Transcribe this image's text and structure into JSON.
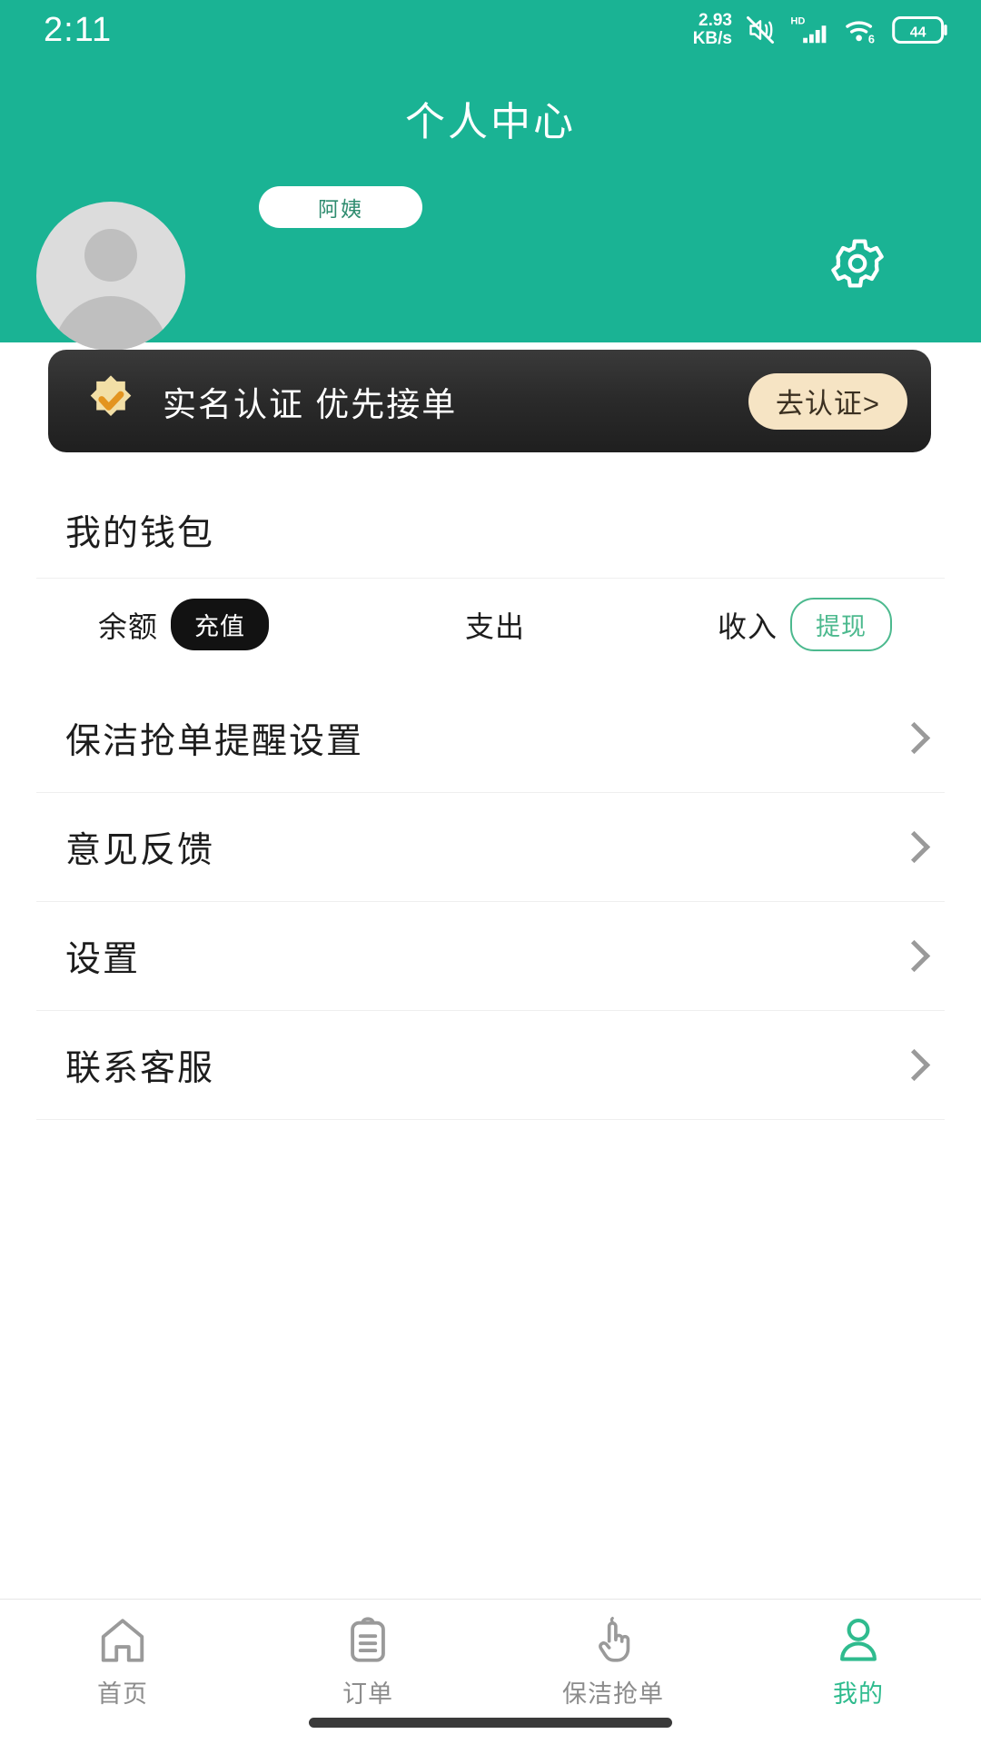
{
  "status_bar": {
    "time": "2:11",
    "net_speed_value": "2.93",
    "net_speed_unit": "KB/s",
    "mute_icon": "mute-icon",
    "hd_label": "HD",
    "signal_icon": "signal-bars-icon",
    "wifi_icon": "wifi-6-icon",
    "battery_level": "44"
  },
  "header": {
    "title": "个人中心",
    "avatar_icon": "default-avatar-icon",
    "role_badge": "阿姨",
    "settings_icon": "gear-icon",
    "background_color": "#1AB394"
  },
  "verify_banner": {
    "badge_icon": "verified-badge-icon",
    "text": "实名认证  优先接单",
    "button_label": "去认证>",
    "card_color": "#2b2b2b",
    "button_color": "#F6E4C4"
  },
  "wallet": {
    "title": "我的钱包",
    "cells": [
      {
        "label": "余额",
        "action": "充值",
        "action_style": "dark"
      },
      {
        "label": "支出",
        "action": "",
        "action_style": "none"
      },
      {
        "label": "收入",
        "action": "提现",
        "action_style": "outline"
      }
    ]
  },
  "menu": {
    "items": [
      {
        "label": "保洁抢单提醒设置",
        "chevron": "chevron-right-icon"
      },
      {
        "label": "意见反馈",
        "chevron": "chevron-right-icon"
      },
      {
        "label": "设置",
        "chevron": "chevron-right-icon"
      },
      {
        "label": "联系客服",
        "chevron": "chevron-right-icon"
      }
    ]
  },
  "tabbar": {
    "active_color": "#2FBB8E",
    "inactive_color": "#8C8C8C",
    "items": [
      {
        "label": "首页",
        "icon": "home-icon",
        "active": false
      },
      {
        "label": "订单",
        "icon": "clipboard-icon",
        "active": false
      },
      {
        "label": "保洁抢单",
        "icon": "tap-hand-icon",
        "active": false
      },
      {
        "label": "我的",
        "icon": "person-icon",
        "active": true
      }
    ]
  }
}
